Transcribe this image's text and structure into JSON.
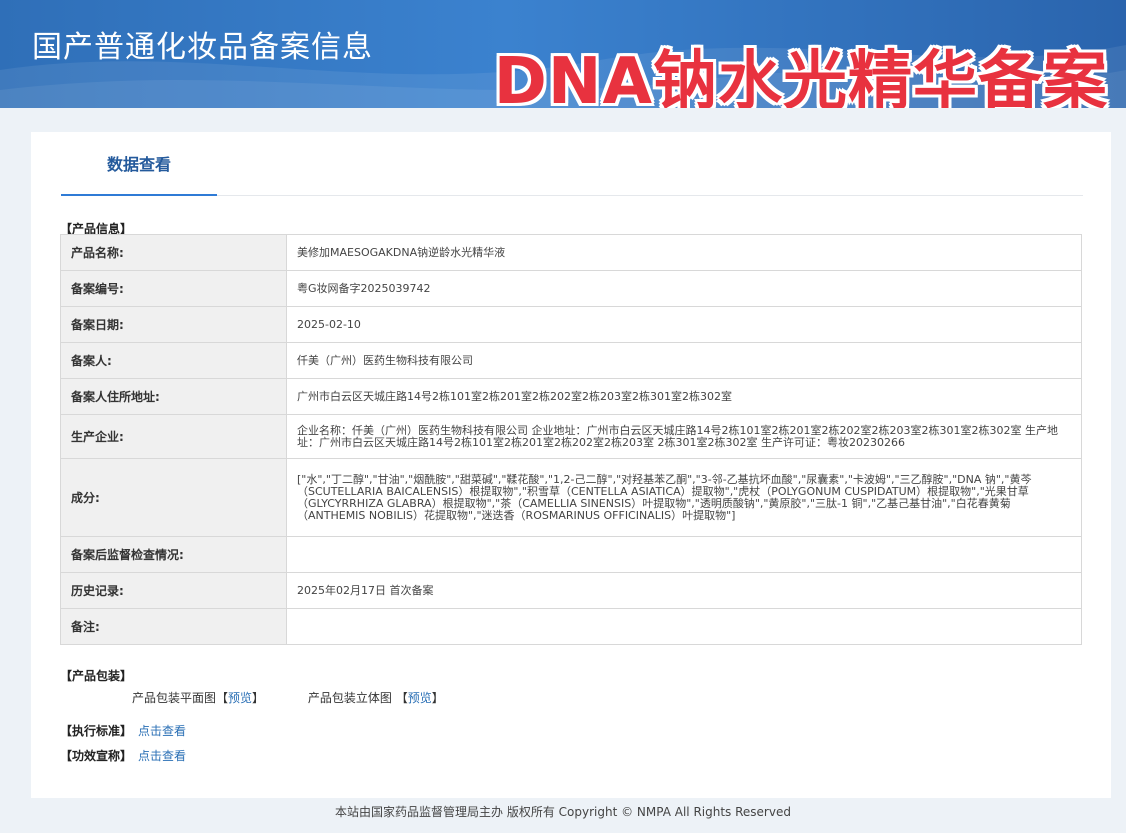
{
  "header": {
    "site_title": "国产普通化妆品备案信息",
    "overlay_title": "DNA钠水光精华备案"
  },
  "tabs": [
    {
      "label": "数据查看",
      "active": true
    }
  ],
  "product_info": {
    "heading": "【产品信息】",
    "rows": [
      {
        "label": "产品名称:",
        "value": "美修加MAESOGAKDNA钠逆龄水光精华液"
      },
      {
        "label": "备案编号:",
        "value": "粤G妆网备字2025039742"
      },
      {
        "label": "备案日期:",
        "value": "2025-02-10"
      },
      {
        "label": "备案人:",
        "value": "仟美（广州）医药生物科技有限公司"
      },
      {
        "label": "备案人住所地址:",
        "value": "广州市白云区天城庄路14号2栋101室2栋201室2栋202室2栋203室2栋301室2栋302室"
      },
      {
        "label": "生产企业:",
        "value": "企业名称：仟美（广州）医药生物科技有限公司 企业地址：广州市白云区天城庄路14号2栋101室2栋201室2栋202室2栋203室2栋301室2栋302室 生产地址：广州市白云区天城庄路14号2栋101室2栋201室2栋202室2栋203室 2栋301室2栋302室 生产许可证：粤妆20230266"
      },
      {
        "label": "成分:",
        "value": "[\"水\",\"丁二醇\",\"甘油\",\"烟酰胺\",\"甜菜碱\",\"鞣花酸\",\"1,2-己二醇\",\"对羟基苯乙酮\",\"3-邻-乙基抗坏血酸\",\"尿囊素\",\"卡波姆\",\"三乙醇胺\",\"DNA 钠\",\"黄芩（SCUTELLARIA BAICALENSIS）根提取物\",\"积雪草（CENTELLA ASIATICA）提取物\",\"虎杖（POLYGONUM CUSPIDATUM）根提取物\",\"光果甘草（GLYCYRRHIZA GLABRA）根提取物\",\"茶（CAMELLIA SINENSIS）叶提取物\",\"透明质酸钠\",\"黄原胶\",\"三肽-1 铜\",\"乙基己基甘油\",\"白花春黄菊（ANTHEMIS NOBILIS）花提取物\",\"迷迭香（ROSMARINUS OFFICINALIS）叶提取物\"]"
      },
      {
        "label": "备案后监督检查情况:",
        "value": ""
      },
      {
        "label": "历史记录:",
        "value": "2025年02月17日 首次备案"
      },
      {
        "label": "备注:",
        "value": ""
      }
    ]
  },
  "packaging": {
    "heading": "【产品包装】",
    "flat_label": "产品包装平面图",
    "stereo_label": "产品包装立体图",
    "bracket_open": "【",
    "bracket_close": "】",
    "preview_link": "预览"
  },
  "standard": {
    "label": "【执行标准】",
    "link": "点击查看"
  },
  "efficacy": {
    "label": "【功效宣称】",
    "link": "点击查看"
  },
  "footer": {
    "text": "本站由国家药品监督管理局主办 版权所有 Copyright © NMPA All Rights Reserved"
  }
}
